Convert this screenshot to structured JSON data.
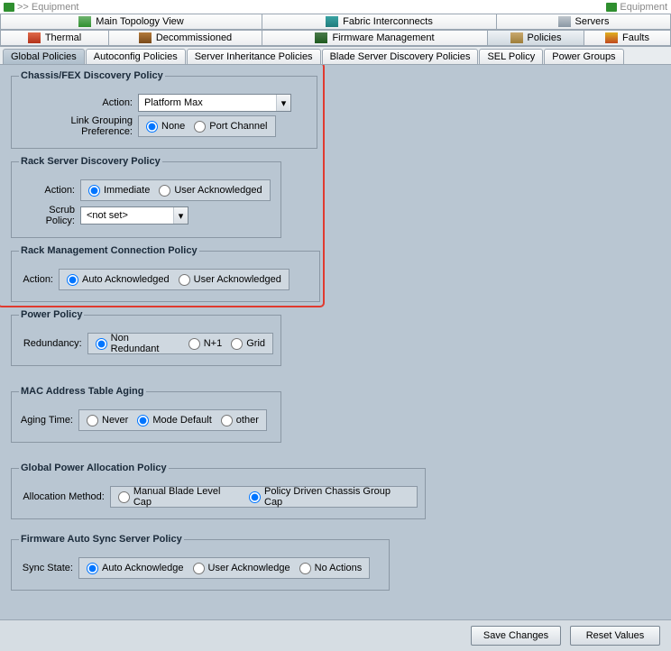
{
  "breadcrumb": {
    "left": ">> Equipment",
    "right": "Equipment",
    "icon": "equipment-icon"
  },
  "nav_row1": [
    {
      "label": "Main Topology View",
      "icon": "topology-icon",
      "icon_class": "ic-topology"
    },
    {
      "label": "Fabric Interconnects",
      "icon": "fabric-icon",
      "icon_class": "ic-fabric"
    },
    {
      "label": "Servers",
      "icon": "servers-icon",
      "icon_class": "ic-servers"
    }
  ],
  "nav_row2": [
    {
      "label": "Thermal",
      "icon": "thermal-icon",
      "icon_class": "ic-thermal"
    },
    {
      "label": "Decommissioned",
      "icon": "decommissioned-icon",
      "icon_class": "ic-decom"
    },
    {
      "label": "Firmware Management",
      "icon": "firmware-icon",
      "icon_class": "ic-firmware"
    },
    {
      "label": "Policies",
      "icon": "policies-icon",
      "icon_class": "ic-policies",
      "selected": true
    },
    {
      "label": "Faults",
      "icon": "faults-icon",
      "icon_class": "ic-faults"
    }
  ],
  "sub_tabs": [
    {
      "label": "Global Policies",
      "selected": true
    },
    {
      "label": "Autoconfig Policies"
    },
    {
      "label": "Server Inheritance Policies"
    },
    {
      "label": "Blade Server Discovery Policies"
    },
    {
      "label": "SEL Policy"
    },
    {
      "label": "Power Groups"
    }
  ],
  "chassis_fex": {
    "legend": "Chassis/FEX Discovery Policy",
    "action_label": "Action:",
    "action_value": "Platform Max",
    "link_grouping_label": "Link Grouping Preference:",
    "options": [
      {
        "label": "None",
        "checked": true
      },
      {
        "label": "Port Channel",
        "checked": false
      }
    ]
  },
  "rack_server": {
    "legend": "Rack Server Discovery Policy",
    "action_label": "Action:",
    "options": [
      {
        "label": "Immediate",
        "checked": true
      },
      {
        "label": "User Acknowledged",
        "checked": false
      }
    ],
    "scrub_label": "Scrub Policy:",
    "scrub_value": "<not set>"
  },
  "rack_mgmt": {
    "legend": "Rack Management Connection Policy",
    "action_label": "Action:",
    "options": [
      {
        "label": "Auto Acknowledged",
        "checked": true
      },
      {
        "label": "User Acknowledged",
        "checked": false
      }
    ]
  },
  "power_policy": {
    "legend": "Power Policy",
    "redundancy_label": "Redundancy:",
    "options": [
      {
        "label": "Non Redundant",
        "checked": true
      },
      {
        "label": "N+1",
        "checked": false
      },
      {
        "label": "Grid",
        "checked": false
      }
    ]
  },
  "mac_aging": {
    "legend": "MAC Address Table Aging",
    "aging_label": "Aging Time:",
    "options": [
      {
        "label": "Never",
        "checked": false
      },
      {
        "label": "Mode Default",
        "checked": true
      },
      {
        "label": "other",
        "checked": false
      }
    ]
  },
  "global_power_alloc": {
    "legend": "Global Power Allocation Policy",
    "alloc_label": "Allocation Method:",
    "options": [
      {
        "label": "Manual Blade Level Cap",
        "checked": false
      },
      {
        "label": "Policy Driven Chassis Group Cap",
        "checked": true
      }
    ]
  },
  "firmware_sync": {
    "legend": "Firmware Auto Sync Server Policy",
    "sync_label": "Sync State:",
    "options": [
      {
        "label": "Auto Acknowledge",
        "checked": true
      },
      {
        "label": "User Acknowledge",
        "checked": false
      },
      {
        "label": "No Actions",
        "checked": false
      }
    ]
  },
  "footer": {
    "save": "Save Changes",
    "reset": "Reset Values"
  }
}
